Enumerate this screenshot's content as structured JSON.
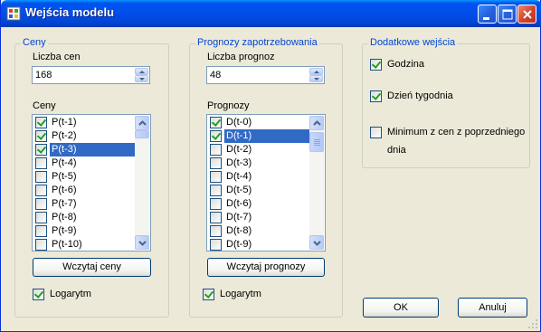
{
  "window": {
    "title": "Wejścia modelu",
    "colors": {
      "titlebar": "#0050ee",
      "group_title": "#0046d5",
      "selection": "#316ac5",
      "face": "#ece9d8"
    }
  },
  "ceny": {
    "group_title": "Ceny",
    "count_label": "Liczba cen",
    "count_value": "168",
    "list_label": "Ceny",
    "items": [
      {
        "label": "P(t-1)",
        "checked": true,
        "selected": false
      },
      {
        "label": "P(t-2)",
        "checked": true,
        "selected": false
      },
      {
        "label": "P(t-3)",
        "checked": true,
        "selected": true
      },
      {
        "label": "P(t-4)",
        "checked": false,
        "selected": false
      },
      {
        "label": "P(t-5)",
        "checked": false,
        "selected": false
      },
      {
        "label": "P(t-6)",
        "checked": false,
        "selected": false
      },
      {
        "label": "P(t-7)",
        "checked": false,
        "selected": false
      },
      {
        "label": "P(t-8)",
        "checked": false,
        "selected": false
      },
      {
        "label": "P(t-9)",
        "checked": false,
        "selected": false
      },
      {
        "label": "P(t-10)",
        "checked": false,
        "selected": false
      }
    ],
    "load_button": "Wczytaj ceny",
    "log_label": "Logarytm",
    "log_checked": true
  },
  "prognozy": {
    "group_title": "Prognozy zapotrzebowania",
    "count_label": "Liczba prognoz",
    "count_value": "48",
    "list_label": "Prognozy",
    "items": [
      {
        "label": "D(t-0)",
        "checked": true,
        "selected": false
      },
      {
        "label": "D(t-1)",
        "checked": true,
        "selected": true
      },
      {
        "label": "D(t-2)",
        "checked": false,
        "selected": false
      },
      {
        "label": "D(t-3)",
        "checked": false,
        "selected": false
      },
      {
        "label": "D(t-4)",
        "checked": false,
        "selected": false
      },
      {
        "label": "D(t-5)",
        "checked": false,
        "selected": false
      },
      {
        "label": "D(t-6)",
        "checked": false,
        "selected": false
      },
      {
        "label": "D(t-7)",
        "checked": false,
        "selected": false
      },
      {
        "label": "D(t-8)",
        "checked": false,
        "selected": false
      },
      {
        "label": "D(t-9)",
        "checked": false,
        "selected": false
      }
    ],
    "load_button": "Wczytaj prognozy",
    "log_label": "Logarytm",
    "log_checked": true
  },
  "dodatkowe": {
    "group_title": "Dodatkowe wejścia",
    "hour_label": "Godzina",
    "hour_checked": true,
    "weekday_label": "Dzień tygodnia",
    "weekday_checked": true,
    "min_label_line1": "Minimum z cen z poprzedniego",
    "min_label_line2": "dnia",
    "min_checked": false
  },
  "buttons": {
    "ok": "OK",
    "cancel": "Anuluj"
  }
}
